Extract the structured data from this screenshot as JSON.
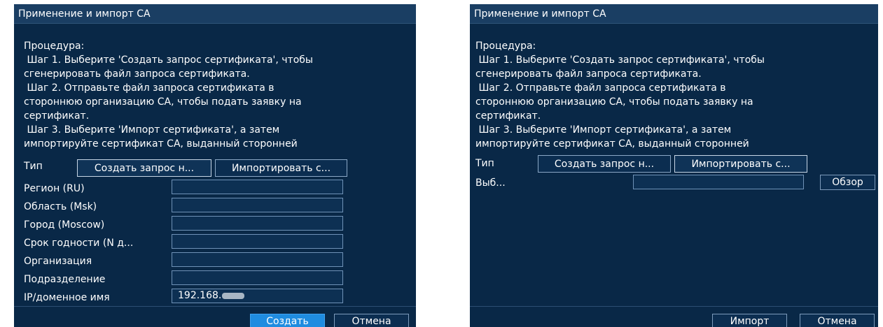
{
  "left": {
    "title": "Применение и импорт CA",
    "procedure": [
      "Процедура:",
      " Шаг 1. Выберите 'Создать запрос сертификата', чтобы",
      "сгенерировать файл запроса сертификата.",
      " Шаг 2. Отправьте файл запроса сертификата в",
      "стороннюю организацию CA, чтобы подать заявку на",
      "сертификат.",
      " Шаг 3. Выберите 'Импорт сертификата', а затем",
      "импортируйте сертификат CA, выданный сторонней"
    ],
    "type_label": "Тип",
    "type_tabs": [
      "Создать запрос н...",
      "Импортировать с..."
    ],
    "fields": [
      {
        "label": "Регион (RU)",
        "value": ""
      },
      {
        "label": "Область (Msk)",
        "value": ""
      },
      {
        "label": "Город (Moscow)",
        "value": ""
      },
      {
        "label": "Срок годности (N д...",
        "value": ""
      },
      {
        "label": "Организация",
        "value": ""
      },
      {
        "label": "Подразделение",
        "value": ""
      },
      {
        "label": "IP/доменное имя",
        "value": "192.168."
      }
    ],
    "create_button": "Создать",
    "cancel_button": "Отмена"
  },
  "right": {
    "title": "Применение и импорт CA",
    "procedure": [
      "Процедура:",
      " Шаг 1. Выберите 'Создать запрос сертификата', чтобы",
      "сгенерировать файл запроса сертификата.",
      " Шаг 2. Отправьте файл запроса сертификата в",
      "стороннюю организацию CA, чтобы подать заявку на",
      "сертификат.",
      " Шаг 3. Выберите 'Импорт сертификата', а затем",
      "импортируйте сертификат CA, выданный сторонней"
    ],
    "type_label": "Тип",
    "type_tabs": [
      "Создать запрос н...",
      "Импортировать с..."
    ],
    "select_label": "Выб...",
    "file_value": "",
    "browse_button": "Обзор",
    "import_button": "Импорт",
    "cancel_button": "Отмена"
  },
  "colors": {
    "panel_bg": "#092847",
    "titlebar_bg": "#1a3e63",
    "accent": "#1f8ce0"
  }
}
